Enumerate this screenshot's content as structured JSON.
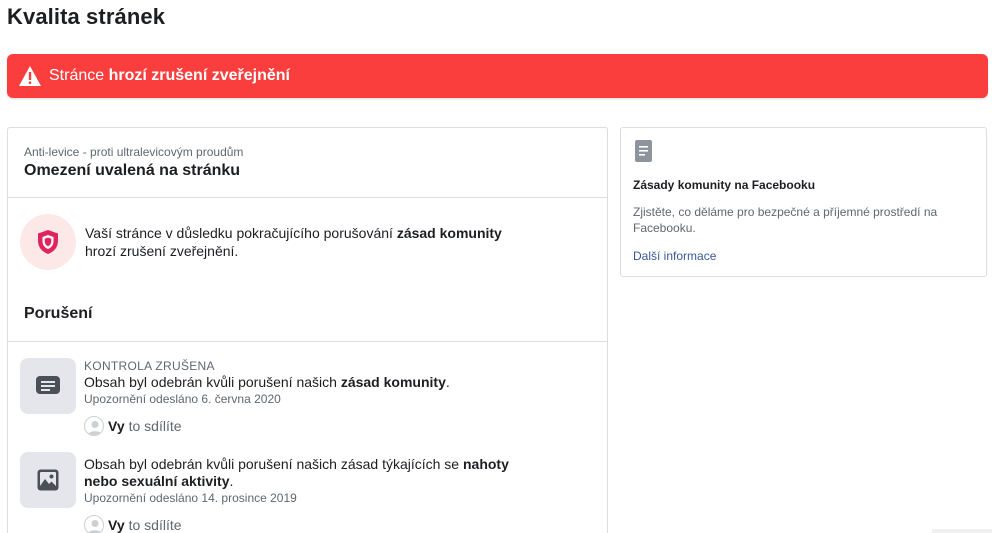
{
  "page": {
    "title": "Kvalita stránek"
  },
  "alert": {
    "prefix": "Stránce",
    "bold": "hrozí zrušení zveřejnění",
    "color": "#fa3e3e"
  },
  "main": {
    "page_name": "Anti-levice - proti ultralevicovým proudům",
    "card_title": "Omezení uvalená na stránku",
    "restriction": {
      "text_before": "Vaší stránce v důsledku pokračujícího porušování ",
      "text_bold": "zásad komunity",
      "text_after": "hrozí zrušení zveřejnění."
    },
    "violations_title": "Porušení",
    "violations": [
      {
        "status": "KONTROLA ZRUŠENA",
        "desc_before": "Obsah byl odebrán kvůli porušení našich ",
        "desc_bold": "zásad komunity",
        "desc_after": ".",
        "date": "Upozornění odesláno 6. června 2020",
        "share_bold": "Vy",
        "share_text": "to sdílíte",
        "icon": "comment-icon"
      },
      {
        "status": "",
        "desc_before": "Obsah byl odebrán kvůli porušení našich zásad týkajících se ",
        "desc_bold": "nahoty nebo sexuální aktivity",
        "desc_after": ".",
        "date": "Upozornění odesláno 14. prosince 2019",
        "share_bold": "Vy",
        "share_text": "to sdílíte",
        "icon": "image-icon"
      }
    ]
  },
  "side": {
    "title": "Zásady komunity na Facebooku",
    "text": "Zjistěte, co děláme pro bezpečné a příjemné prostředí na Facebooku.",
    "link": "Další informace"
  }
}
